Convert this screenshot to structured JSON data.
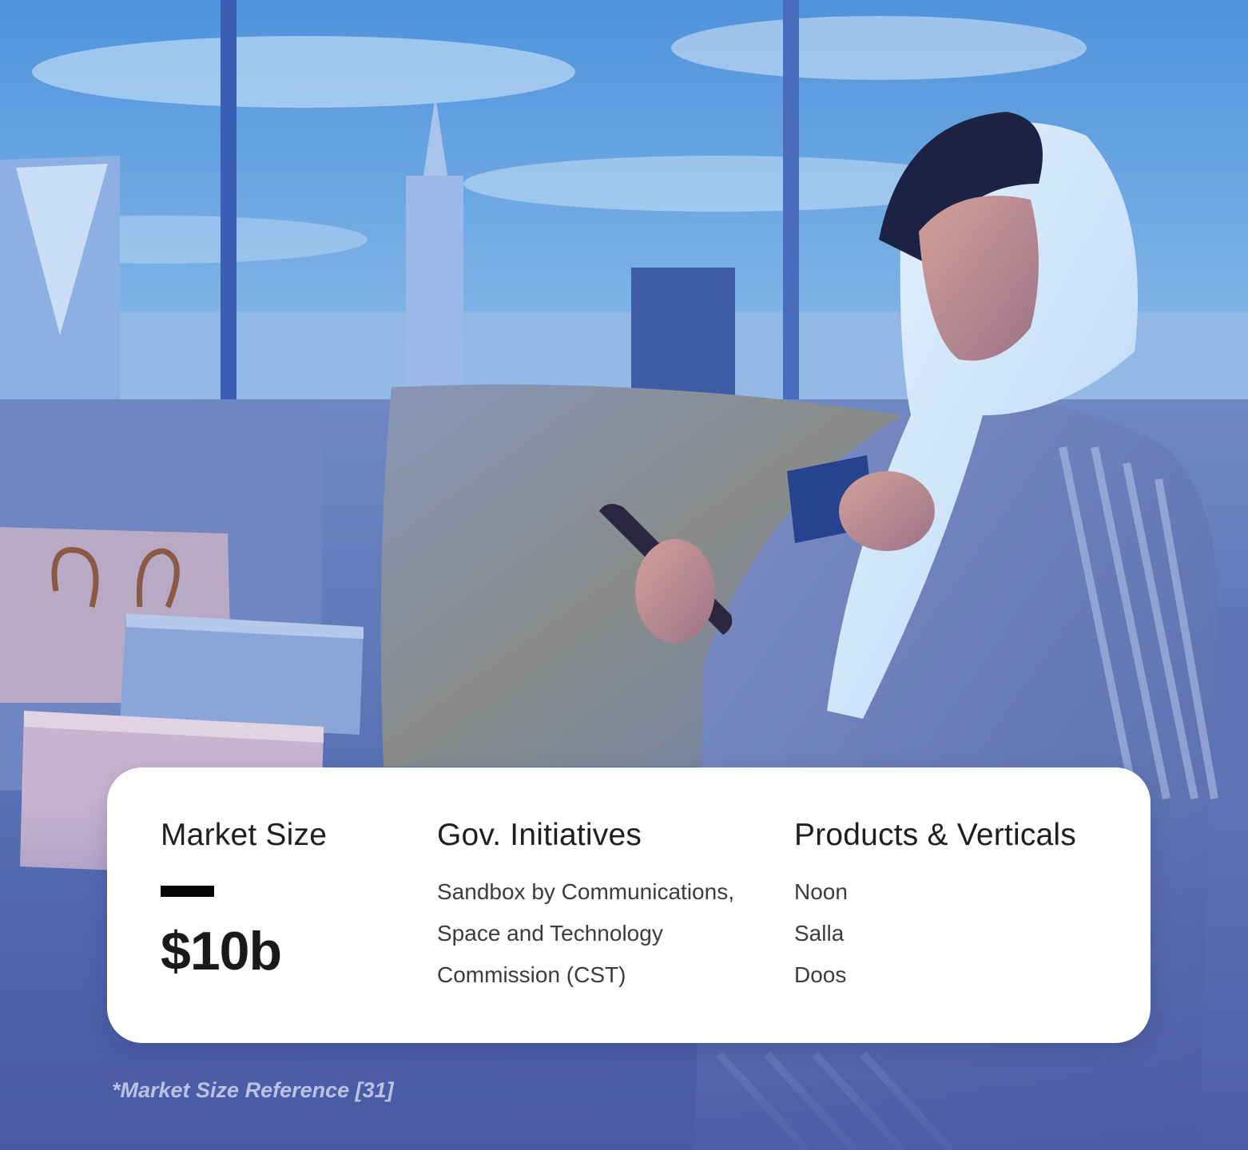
{
  "card": {
    "market_size": {
      "heading": "Market Size",
      "value": "$10b"
    },
    "gov_initiatives": {
      "heading": "Gov. Initiatives",
      "lines": [
        "Sandbox by Communications,",
        "Space and Technology",
        "Commission (CST)"
      ]
    },
    "products_verticals": {
      "heading": "Products & Verticals",
      "items": [
        "Noon",
        "Salla",
        "Doos"
      ]
    }
  },
  "footnote": "*Market Size Reference [31]",
  "colors": {
    "card_background": "#ffffff",
    "heading_text": "#1f1f1f",
    "body_text": "#3c3c3c",
    "accent_dash": "#050505",
    "footnote_text": "#cdd4f0",
    "sky_blue": "#7fb4ea",
    "sofa_blue": "#5f78b8"
  }
}
